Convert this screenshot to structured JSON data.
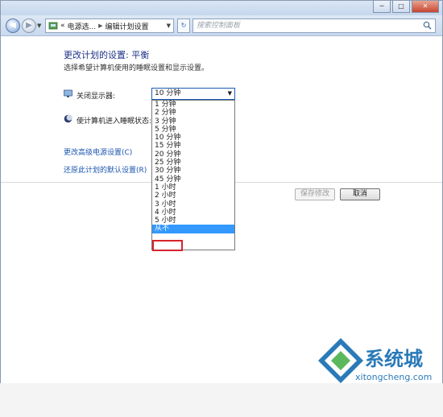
{
  "window": {
    "controls": {
      "minimize": "─",
      "maximize": "□",
      "close": "✕"
    }
  },
  "navbar": {
    "back_glyph": "◀",
    "forward_glyph": "▶",
    "breadcrumb": [
      "电源选...",
      "编辑计划设置"
    ],
    "breadcrumb_prefix": "«",
    "search_placeholder": "搜索控制面板"
  },
  "main": {
    "title": "更改计划的设置: 平衡",
    "subtitle": "选择希望计算机使用的睡眠设置和显示设置。",
    "turn_off_display_label": "关闭显示器:",
    "sleep_label": "使计算机进入睡眠状态:",
    "select_value": "10 分钟",
    "dropdown_options": [
      "1 分钟",
      "2 分钟",
      "3 分钟",
      "5 分钟",
      "10 分钟",
      "15 分钟",
      "20 分钟",
      "25 分钟",
      "30 分钟",
      "45 分钟",
      "1 小时",
      "2 小时",
      "3 小时",
      "4 小时",
      "5 小时",
      "从不"
    ],
    "selected_option_index": 15,
    "link_advanced": "更改高级电源设置(C)",
    "link_restore": "还原此计划的默认设置(R)",
    "save_button": "保存修改",
    "cancel_button": "取消"
  },
  "watermark": {
    "brand": "系统城",
    "url": "xitongcheng.com"
  },
  "colors": {
    "title_blue": "#1e3287",
    "link_blue": "#1c56b0",
    "selection": "#3399ff",
    "highlight_red": "#d8232a"
  }
}
